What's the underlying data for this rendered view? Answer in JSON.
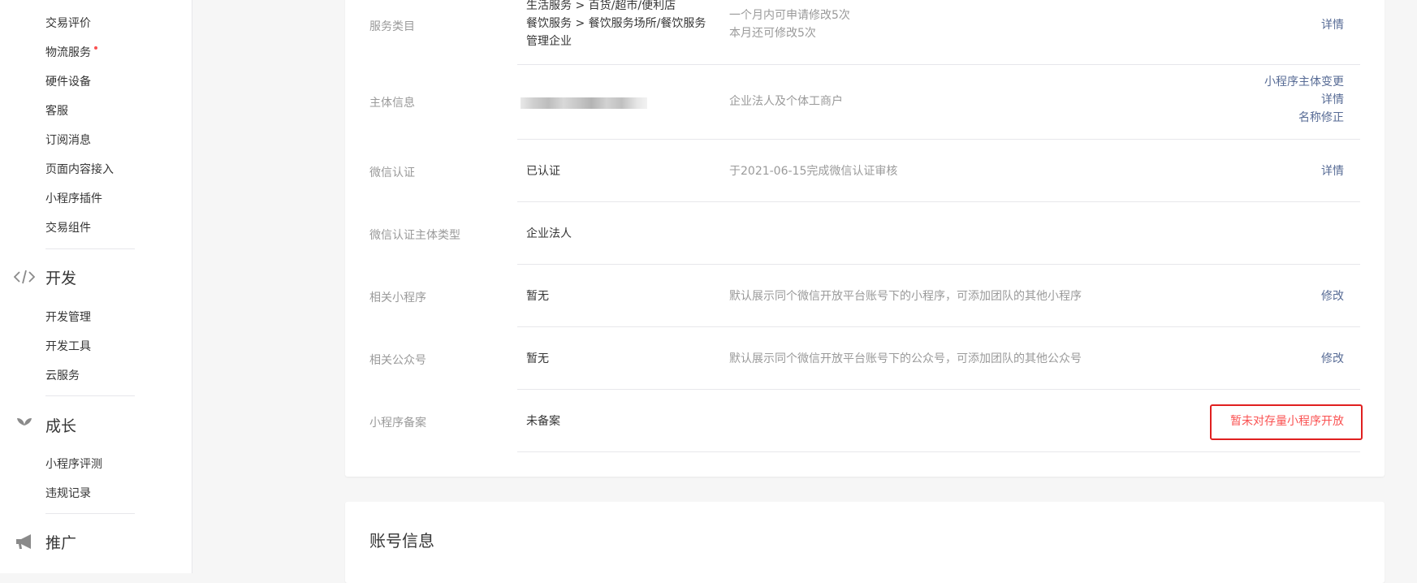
{
  "sidebar": {
    "items_top": [
      {
        "label": "交易评价"
      },
      {
        "label": "物流服务",
        "dot": true
      },
      {
        "label": "硬件设备"
      },
      {
        "label": "客服"
      },
      {
        "label": "订阅消息"
      },
      {
        "label": "页面内容接入"
      },
      {
        "label": "小程序插件"
      },
      {
        "label": "交易组件"
      }
    ],
    "groups": [
      {
        "title": "开发",
        "icon": "code-icon",
        "items": [
          "开发管理",
          "开发工具",
          "云服务"
        ]
      },
      {
        "title": "成长",
        "icon": "sprout-icon",
        "items": [
          "小程序评测",
          "违规记录"
        ]
      },
      {
        "title": "推广",
        "icon": "megaphone-icon",
        "items": []
      }
    ]
  },
  "rows": {
    "category": {
      "label": "服务类目",
      "value": [
        "生活服务 > 百货/超市/便利店",
        "餐饮服务 > 餐饮服务场所/餐饮服务",
        "管理企业"
      ],
      "desc": [
        "一个月内可申请修改5次",
        "本月还可修改5次"
      ],
      "action": "详情"
    },
    "entity": {
      "label": "主体信息",
      "desc": "企业法人及个体工商户",
      "actions": [
        "小程序主体变更",
        "详情",
        "名称修正"
      ]
    },
    "wechat_verify": {
      "label": "微信认证",
      "value": "已认证",
      "desc": "于2021-06-15完成微信认证审核",
      "action": "详情"
    },
    "verify_type": {
      "label": "微信认证主体类型",
      "value": "企业法人"
    },
    "related_mini": {
      "label": "相关小程序",
      "value": "暂无",
      "desc": "默认展示同个微信开放平台账号下的小程序，可添加团队的其他小程序",
      "action": "修改"
    },
    "related_oa": {
      "label": "相关公众号",
      "value": "暂无",
      "desc": "默认展示同个微信开放平台账号下的公众号，可添加团队的其他公众号",
      "action": "修改"
    },
    "filing": {
      "label": "小程序备案",
      "value": "未备案",
      "action": "暂未对存量小程序开放"
    }
  },
  "account_card": {
    "title": "账号信息"
  },
  "colors": {
    "link": "#576b95",
    "warning": "#fa5151",
    "highlight_border": "#e02020"
  }
}
